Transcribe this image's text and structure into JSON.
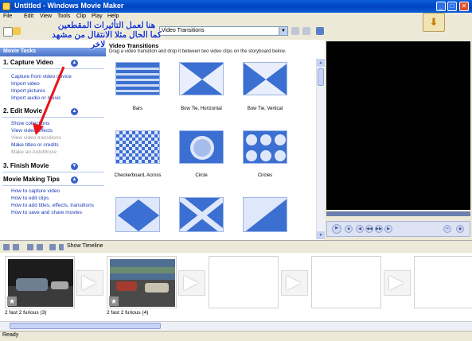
{
  "window": {
    "title": "Untitled - Windows Movie Maker"
  },
  "menu": {
    "items": [
      "File",
      "Edit",
      "View",
      "Tools",
      "Clip",
      "Play",
      "Help"
    ]
  },
  "toolbar": {
    "collection_value": "Video Transitions"
  },
  "tasks": {
    "header": "Movie Tasks",
    "sections": [
      {
        "title": "1. Capture Video",
        "links": [
          "Capture from video device",
          "Import video",
          "Import pictures",
          "Import audio or music"
        ]
      },
      {
        "title": "2. Edit Movie",
        "links": [
          "Show collections",
          "View video effects",
          "View video transitions",
          "Make titles or credits",
          "Make an AutoMovie"
        ]
      },
      {
        "title": "3. Finish Movie",
        "links": []
      },
      {
        "title": "Movie Making Tips",
        "links": [
          "How to capture video",
          "How to edit clips",
          "How to add titles, effects, transitions",
          "How to save and share movies"
        ]
      }
    ]
  },
  "contents": {
    "title": "Video Transitions",
    "description": "Drag a video transition and drop it between two video clips on the storyboard below.",
    "items": [
      "Bars",
      "Bow Tie, Horizontal",
      "Bow Tie, Vertical",
      "Checkerboard, Across",
      "Circle",
      "Circles"
    ]
  },
  "storyboard_toolbar": {
    "show_timeline": "Show Timeline"
  },
  "storyboard": {
    "clips": [
      "2 fast 2 furious (3)",
      "2 fast 2 furious (4)"
    ]
  },
  "status": {
    "text": "Ready"
  },
  "annotation": {
    "lines": [
      "هنا لعمل التأثيرات المقطعين",
      "كما الحال مثلا الانتقال من مشهد",
      "لاخر"
    ],
    "color": "#1734c7",
    "arrow_color": "#e8141a"
  },
  "colors": {
    "accent": "#0349c9",
    "tile_blue": "#3b6fd1"
  }
}
